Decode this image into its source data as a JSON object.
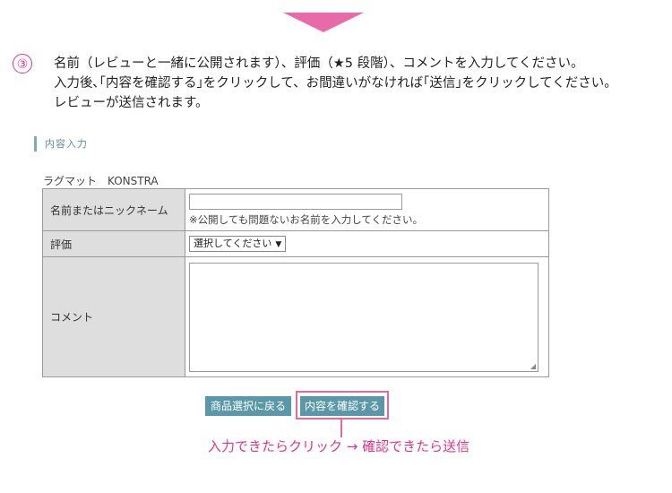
{
  "step": {
    "number": "③",
    "lines": [
      "名前（レビューと一緒に公開されます）、評価（★5 段階）、コメントを入力してください。",
      "入力後､｢内容を確認する｣をクリックして、お間違いがなければ｢送信｣をクリックしてください。",
      "レビューが送信されます。"
    ]
  },
  "section_title": "内容入力",
  "product_name": "ラグマット　KONSTRA",
  "form": {
    "name_label": "名前またはニックネーム",
    "name_value": "",
    "name_hint": "※公開しても問題ないお名前を入力してください。",
    "rating_label": "評価",
    "rating_selected": "選択してください",
    "comment_label": "コメント",
    "comment_value": ""
  },
  "buttons": {
    "back": "商品選択に戻る",
    "confirm": "内容を確認する"
  },
  "callout": "入力できたらクリック → 確認できたら送信",
  "colors": {
    "accent_pink": "#e0368a",
    "button_teal": "#5a97a8",
    "label_bg": "#dedede"
  }
}
